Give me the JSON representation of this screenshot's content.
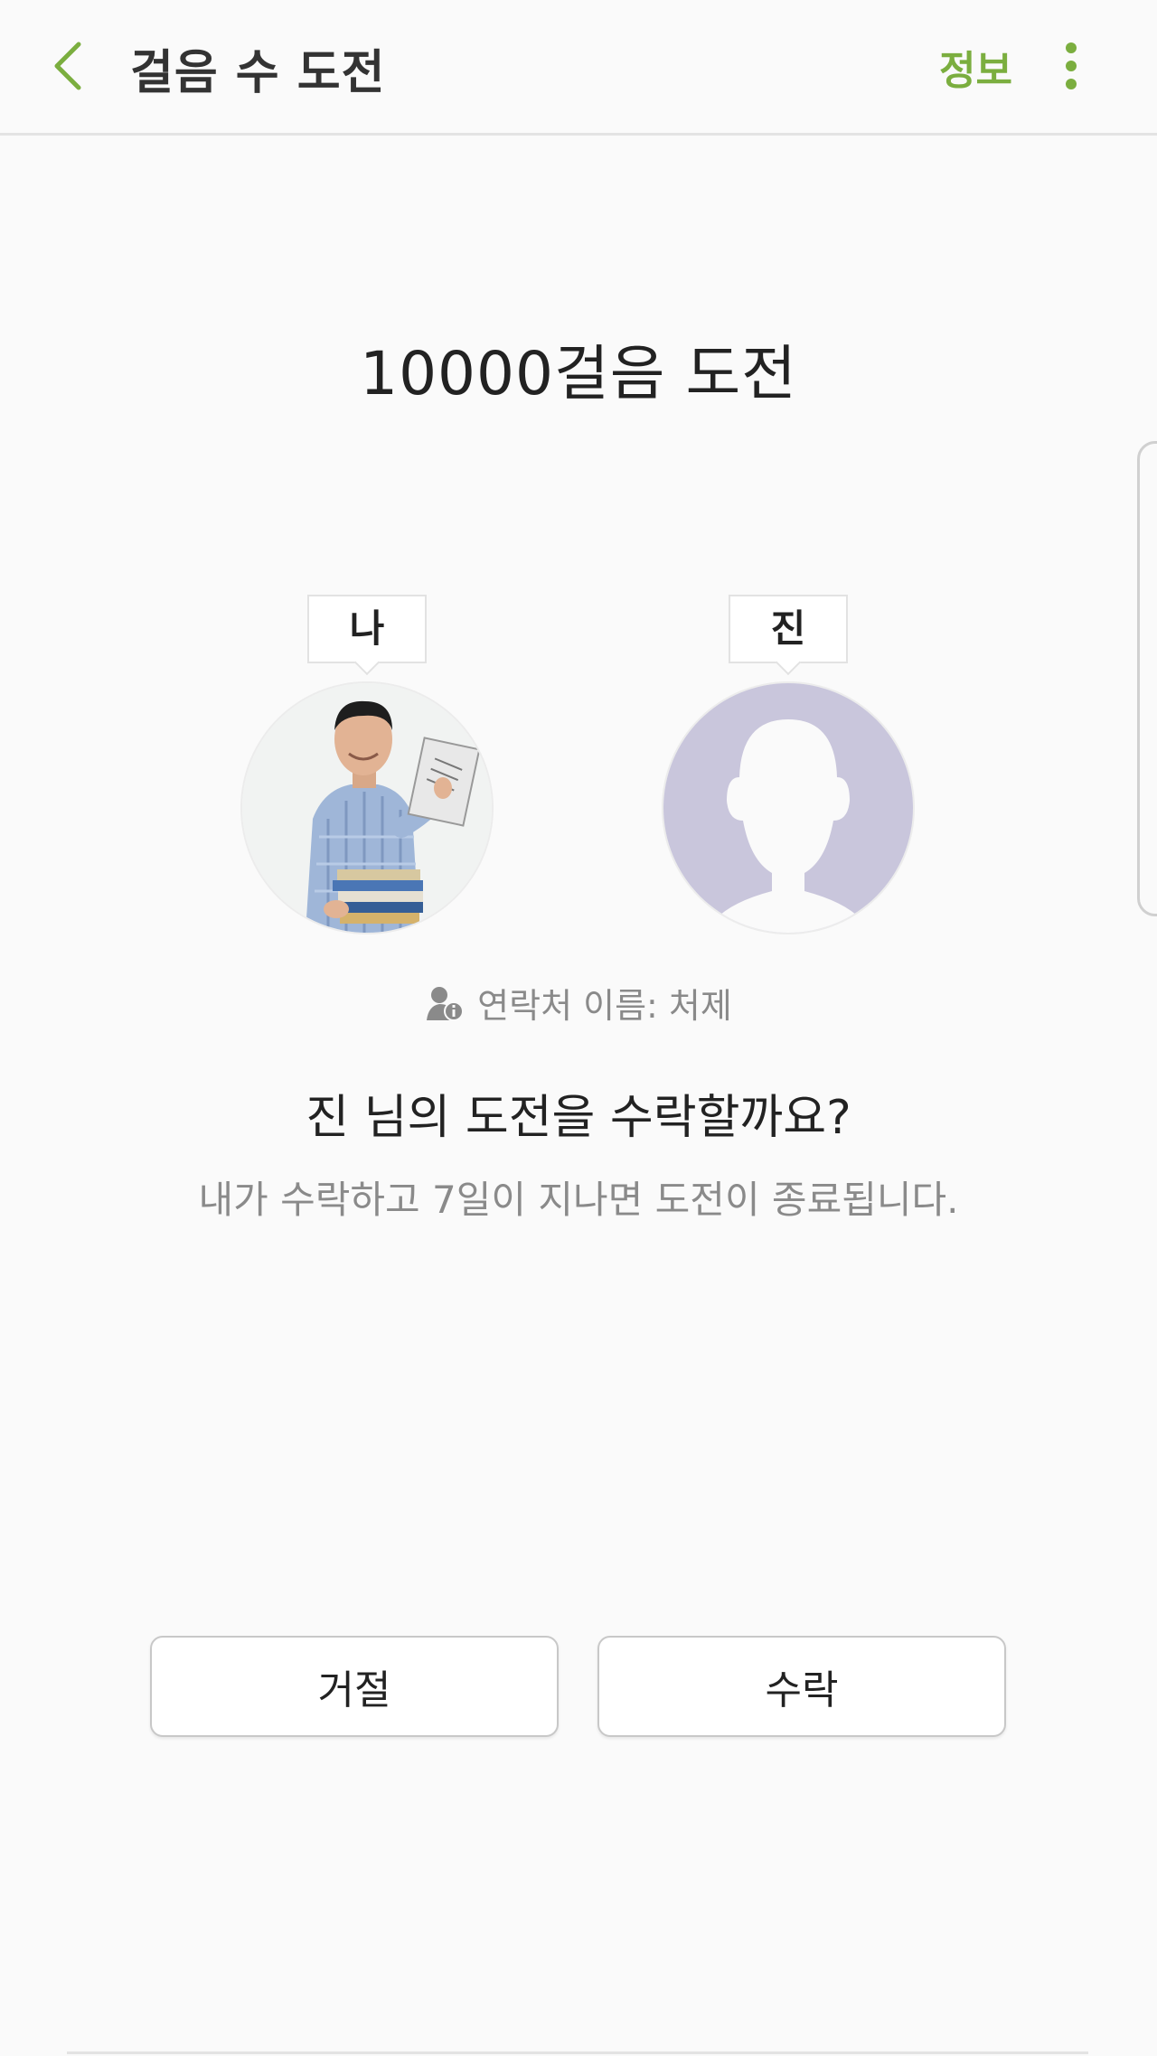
{
  "app_bar": {
    "title": "걸음 수 도전",
    "info_label": "정보",
    "back_icon": "chevron-left-icon",
    "more_icon": "more-vertical-icon",
    "accent_color": "#7bae3f"
  },
  "challenge": {
    "title": "10000걸음 도전"
  },
  "participants": [
    {
      "name": "나",
      "avatar": "photo-of-man-holding-book"
    },
    {
      "name": "진",
      "avatar": "default-silhouette-avatar",
      "avatar_color": "#c9c6dc"
    }
  ],
  "contact": {
    "text": "연락처 이름: 처제",
    "icon": "contact-info-icon"
  },
  "prompt": {
    "question": "진 님의 도전을 수락할까요?",
    "note": "내가 수락하고 7일이 지나면 도전이 종료됩니다."
  },
  "actions": {
    "reject_label": "거절",
    "accept_label": "수락"
  }
}
